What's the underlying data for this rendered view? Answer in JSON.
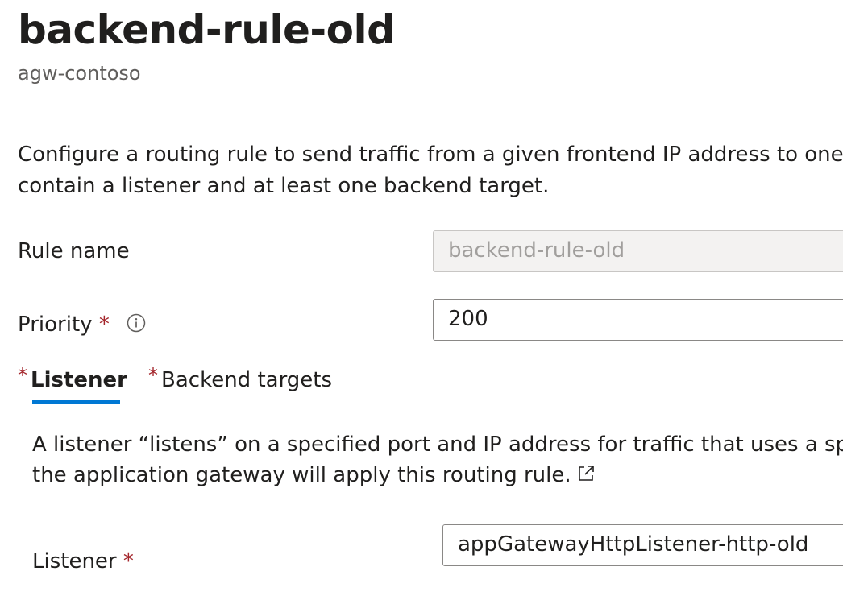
{
  "header": {
    "title": "backend-rule-old",
    "subtitle": "agw-contoso"
  },
  "description": {
    "line1": "Configure a routing rule to send traffic from a given frontend IP address to one or",
    "line2": "contain a listener and at least one backend target."
  },
  "form": {
    "rule_name_label": "Rule name",
    "rule_name_value": "backend-rule-old",
    "priority_label": "Priority",
    "required_mark": "*",
    "priority_value": "200"
  },
  "tabs": [
    {
      "label": "Listener",
      "active": true
    },
    {
      "label": "Backend targets",
      "active": false
    }
  ],
  "listener_section": {
    "desc_line1": "A listener “listens” on a specified port and IP address for traffic that uses a specif",
    "desc_line2": "the application gateway will apply this routing rule.",
    "listener_label": "Listener",
    "listener_value": "appGatewayHttpListener-http-old"
  },
  "icons": {
    "info": "info-icon",
    "external_link": "external-link-icon"
  },
  "colors": {
    "accent": "#0078d4",
    "required": "#a4262c",
    "disabled_bg": "#f3f2f1"
  }
}
